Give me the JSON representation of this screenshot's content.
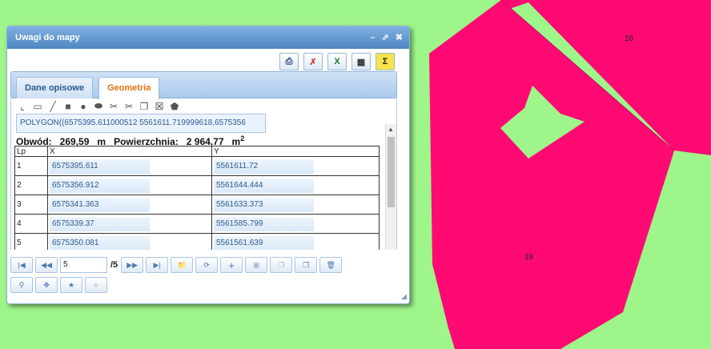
{
  "map": {
    "background": "#9ef58a",
    "parcel_color": "#ff0a73",
    "labels": [
      "18",
      "19"
    ]
  },
  "window": {
    "title": "Uwagi do mapy",
    "controls": [
      "minimize-icon",
      "restore-icon",
      "close-icon"
    ]
  },
  "top_toolbar": [
    "print-icon",
    "no-draw-icon",
    "excel-icon",
    "table-icon",
    "sum-icon"
  ],
  "tabs": [
    "Dane opisowe",
    "Geometria"
  ],
  "active_tab": "Geometria",
  "geometry": {
    "wkt": "POLYGON((6575395.611000512 5561611.719999618,6575356",
    "perimeter_label": "Obwód:",
    "perimeter_value": "269,59",
    "perimeter_unit": "m",
    "area_label": "Powierzchnia:",
    "area_value": "2 964,77",
    "area_unit": "m",
    "area_unit_sup": "2",
    "columns": [
      "Lp",
      "X",
      "Y"
    ],
    "rows": [
      {
        "lp": "1",
        "x": "6575395.611",
        "y": "5561611.72"
      },
      {
        "lp": "2",
        "x": "6575356.912",
        "y": "5561644.444"
      },
      {
        "lp": "3",
        "x": "6575341.363",
        "y": "5561633.373"
      },
      {
        "lp": "4",
        "x": "6575339.37",
        "y": "5561585.799"
      },
      {
        "lp": "5",
        "x": "6575350.081",
        "y": "5561561.639"
      }
    ]
  },
  "pager": {
    "current": "5",
    "total": "/5"
  }
}
